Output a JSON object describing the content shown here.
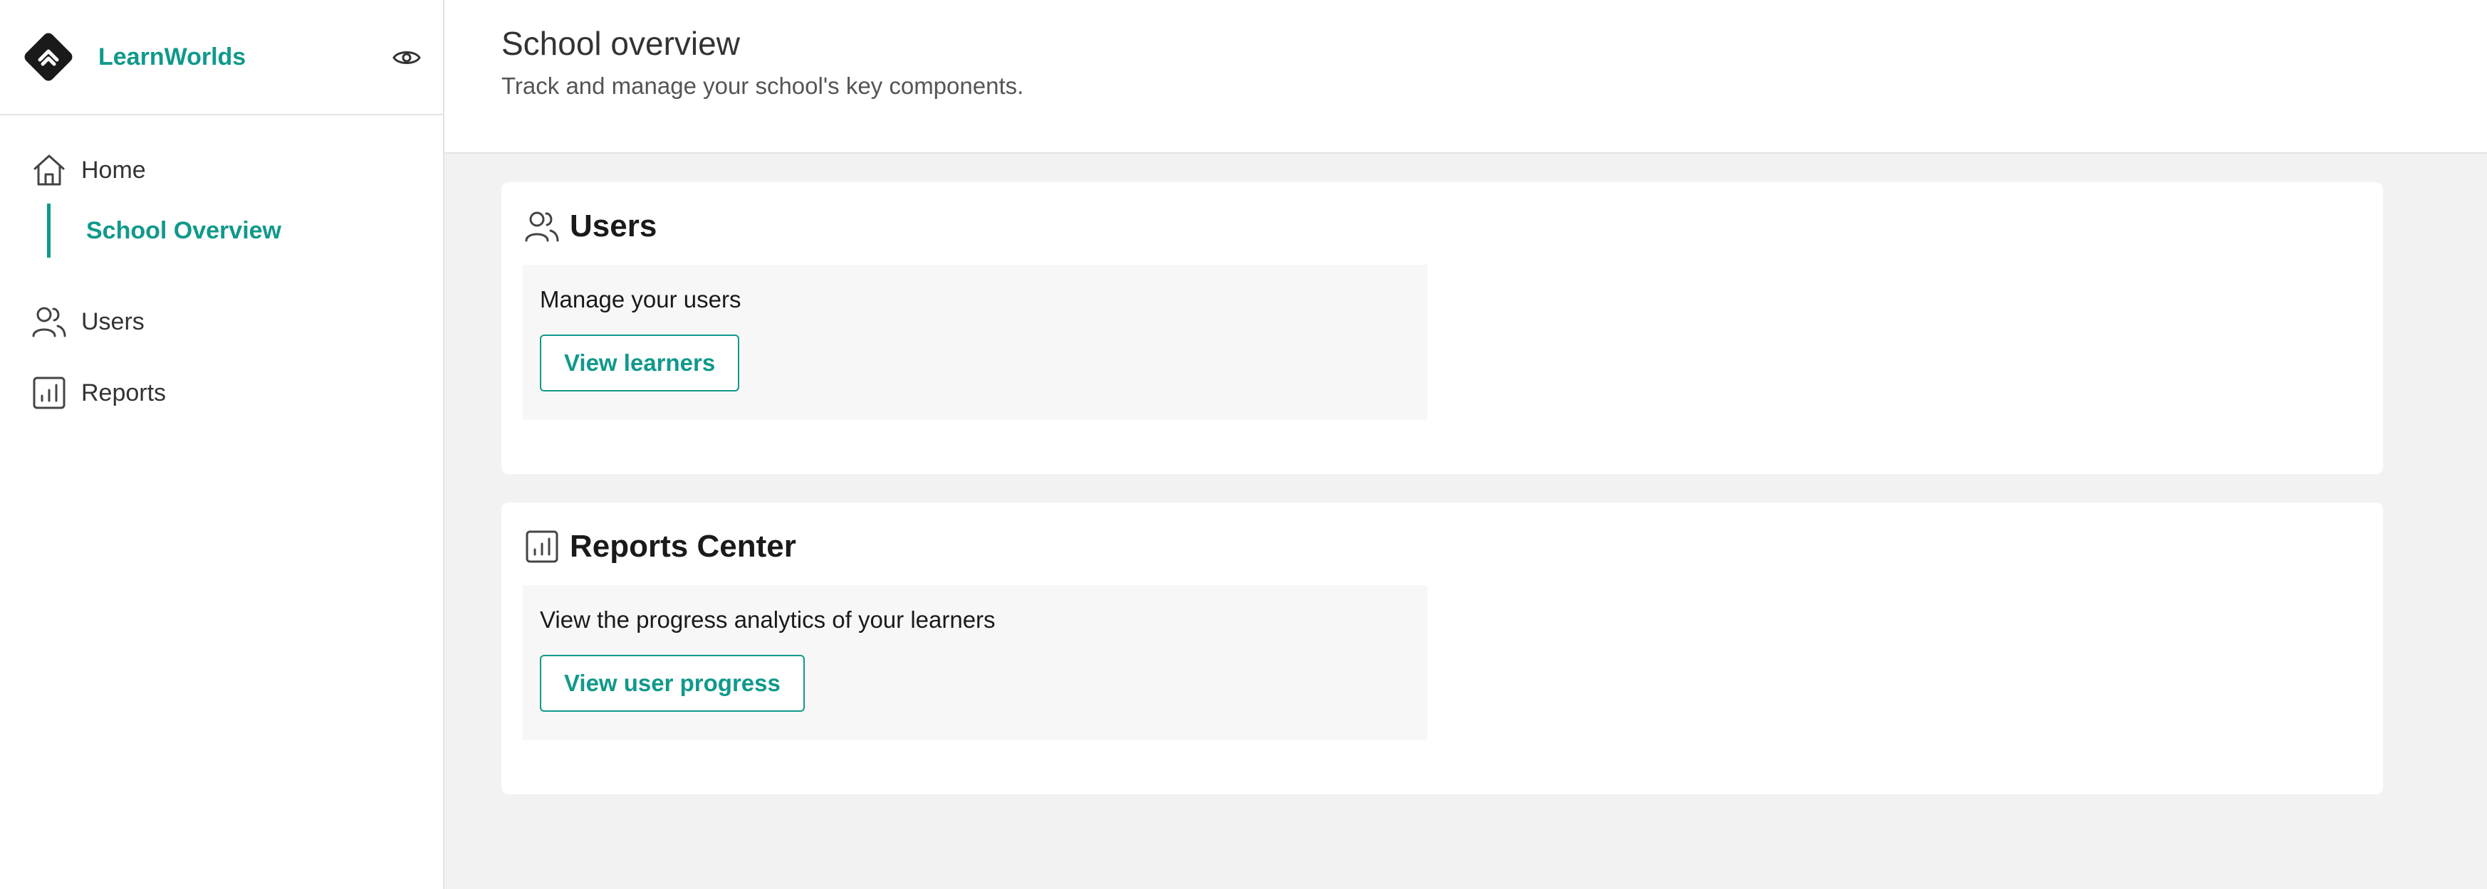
{
  "brand": {
    "name": "LearnWorlds"
  },
  "sidebar": {
    "items": [
      {
        "label": "Home",
        "icon": "home-icon"
      },
      {
        "label": "School Overview",
        "active": true
      },
      {
        "label": "Users",
        "icon": "users-icon"
      },
      {
        "label": "Reports",
        "icon": "reports-icon"
      }
    ]
  },
  "header": {
    "title": "School overview",
    "subtitle": "Track and manage your school's key components."
  },
  "cards": [
    {
      "title": "Users",
      "icon": "users-icon",
      "description": "Manage your users",
      "button_label": "View learners"
    },
    {
      "title": "Reports Center",
      "icon": "reports-icon",
      "description": "View the progress analytics of your learners",
      "button_label": "View user progress"
    }
  ],
  "colors": {
    "accent": "#10998b",
    "background": "#f2f2f2",
    "surface": "#ffffff",
    "card_body": "#f7f7f7"
  }
}
